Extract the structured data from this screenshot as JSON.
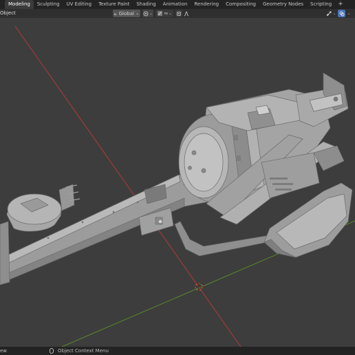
{
  "workspace_tabs": [
    {
      "label": "",
      "active": false
    },
    {
      "label": "Modeling",
      "active": true
    },
    {
      "label": "Sculpting",
      "active": false
    },
    {
      "label": "UV Editing",
      "active": false
    },
    {
      "label": "Texture Paint",
      "active": false
    },
    {
      "label": "Shading",
      "active": false
    },
    {
      "label": "Animation",
      "active": false
    },
    {
      "label": "Rendering",
      "active": false
    },
    {
      "label": "Compositing",
      "active": false
    },
    {
      "label": "Geometry Nodes",
      "active": false
    },
    {
      "label": "Scripting",
      "active": false
    }
  ],
  "add_tab_label": "+",
  "header": {
    "menu_label": "Object",
    "orientation": "Global",
    "snap_label": "nc"
  },
  "status": {
    "left_label": "ew",
    "context_menu": "Object Context Menu"
  },
  "icons": [
    "transform-orientation-icon",
    "pivot-icon",
    "snap-icon",
    "proportional-edit-icon",
    "falloff-icon",
    "gizmo-icon",
    "overlay-icon",
    "mouse-icon"
  ],
  "colors": {
    "x_axis": "#b33a3a",
    "y_axis": "#5a8a2a",
    "active_tab": "#3b3b3b",
    "selected_button": "#4772b3"
  }
}
